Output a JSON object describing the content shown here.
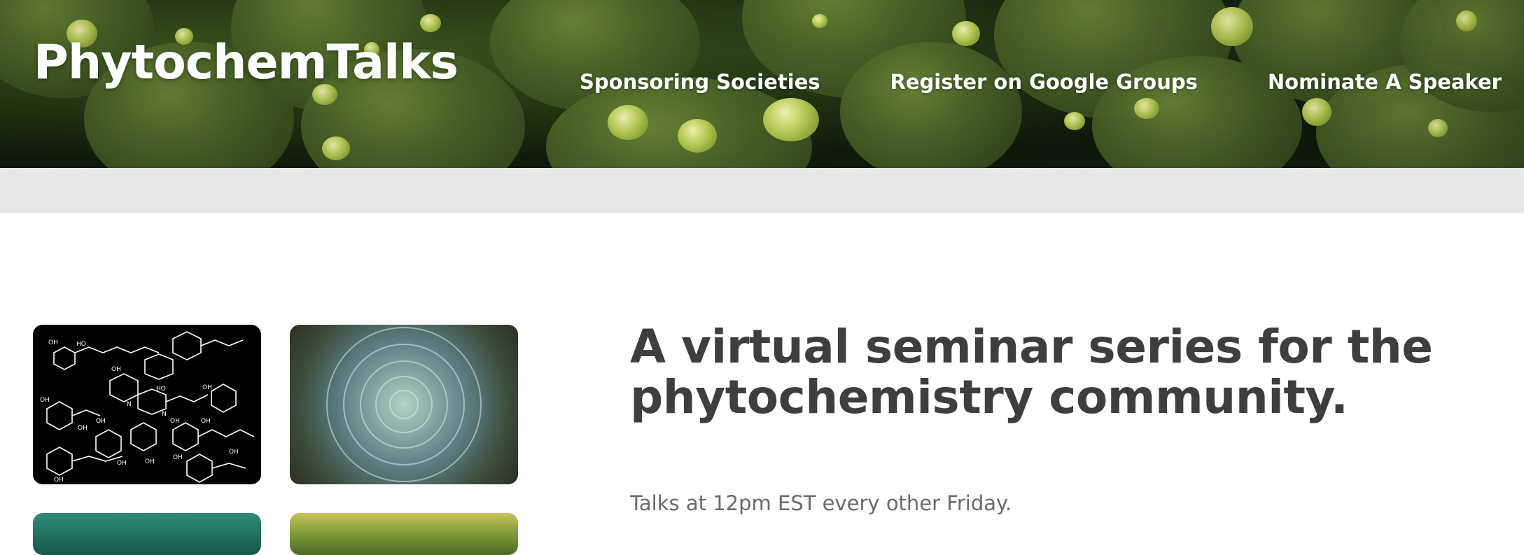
{
  "site": {
    "title": "PhytochemTalks"
  },
  "nav": {
    "items": [
      {
        "label": "Sponsoring Societies"
      },
      {
        "label": "Register on Google Groups"
      },
      {
        "label": "Nominate A Speaker"
      }
    ]
  },
  "hero": {
    "headline": "A virtual seminar series for the phytochemistry community.",
    "subtext": "Talks at 12pm EST every other Friday."
  },
  "gallery": {
    "images": [
      {
        "name": "chemical-structures-image",
        "molecule_labels": [
          "OH",
          "HO",
          "OH",
          "HO",
          "OH",
          "OH",
          "OH",
          "N",
          "OH",
          "OH",
          "OH",
          "OH",
          "OH",
          "OH",
          "OH",
          "OH",
          "N"
        ]
      },
      {
        "name": "succulent-rosette-image"
      },
      {
        "name": "bowl-image"
      },
      {
        "name": "grass-image"
      }
    ]
  },
  "colors": {
    "headline": "#3e3e3e",
    "subtext": "#6a6a6a",
    "nav_text": "#ffffff",
    "band": "#e9e9e9"
  }
}
